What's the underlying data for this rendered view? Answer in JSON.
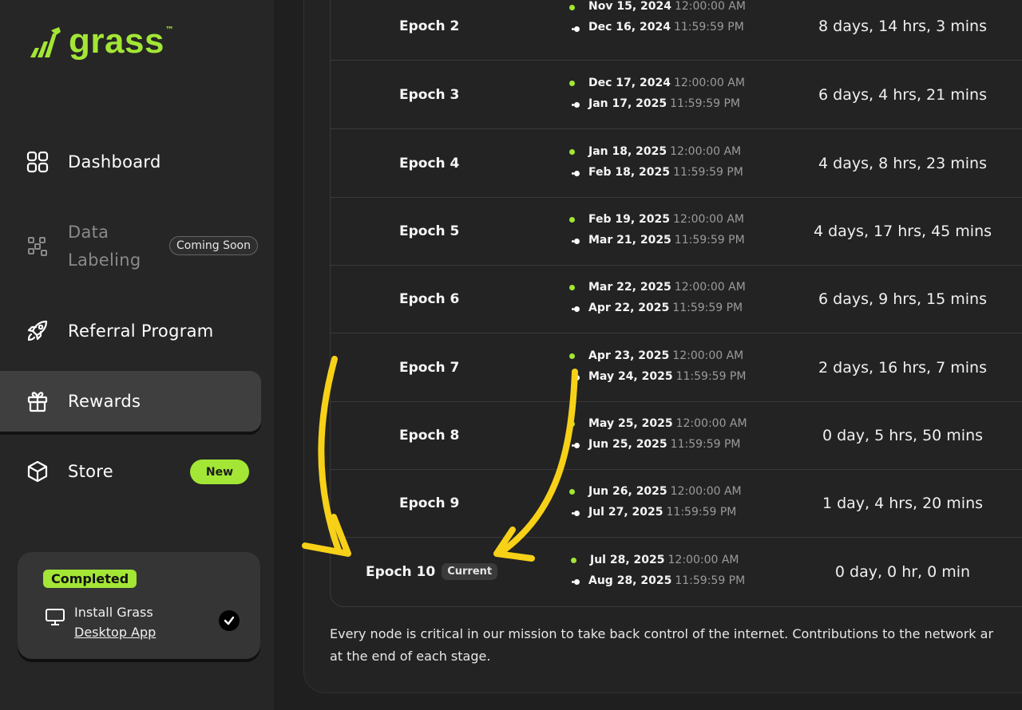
{
  "brand": {
    "name": "grass",
    "tm": "™",
    "accent": "#a3e635"
  },
  "sidebar": {
    "items": [
      {
        "label": "Dashboard",
        "icon": "grid-icon"
      },
      {
        "label": "Data Labeling",
        "line1": "Data",
        "line2": "Labeling",
        "icon": "data-labeling-icon",
        "badge": "Coming Soon"
      },
      {
        "label": "Referral Program",
        "icon": "rocket-icon"
      },
      {
        "label": "Rewards",
        "icon": "gift-icon",
        "active": true
      },
      {
        "label": "Store",
        "icon": "box-icon",
        "badge": "New"
      }
    ],
    "task": {
      "status": "Completed",
      "line1": "Install Grass",
      "line2": "Desktop App",
      "icon": "monitor-icon",
      "check_icon": "check-icon"
    }
  },
  "epochs": [
    {
      "name": "Epoch 2",
      "start_date": "Nov 15, 2024",
      "start_time": "12:00:00 AM",
      "end_date": "Dec 16, 2024",
      "end_time": "11:59:59 PM",
      "duration": "8 days, 14 hrs, 3 mins"
    },
    {
      "name": "Epoch 3",
      "start_date": "Dec 17, 2024",
      "start_time": "12:00:00 AM",
      "end_date": "Jan 17, 2025",
      "end_time": "11:59:59 PM",
      "duration": "6 days, 4 hrs, 21 mins"
    },
    {
      "name": "Epoch 4",
      "start_date": "Jan 18, 2025",
      "start_time": "12:00:00 AM",
      "end_date": "Feb 18, 2025",
      "end_time": "11:59:59 PM",
      "duration": "4 days, 8 hrs, 23 mins"
    },
    {
      "name": "Epoch 5",
      "start_date": "Feb 19, 2025",
      "start_time": "12:00:00 AM",
      "end_date": "Mar 21, 2025",
      "end_time": "11:59:59 PM",
      "duration": "4 days, 17 hrs, 45 mins"
    },
    {
      "name": "Epoch 6",
      "start_date": "Mar 22, 2025",
      "start_time": "12:00:00 AM",
      "end_date": "Apr 22, 2025",
      "end_time": "11:59:59 PM",
      "duration": "6 days, 9 hrs, 15 mins"
    },
    {
      "name": "Epoch 7",
      "start_date": "Apr 23, 2025",
      "start_time": "12:00:00 AM",
      "end_date": "May 24, 2025",
      "end_time": "11:59:59 PM",
      "duration": "2 days, 16 hrs, 7 mins"
    },
    {
      "name": "Epoch 8",
      "start_date": "May 25, 2025",
      "start_time": "12:00:00 AM",
      "end_date": "Jun 25, 2025",
      "end_time": "11:59:59 PM",
      "duration": "0 day, 5 hrs, 50 mins"
    },
    {
      "name": "Epoch 9",
      "start_date": "Jun 26, 2025",
      "start_time": "12:00:00 AM",
      "end_date": "Jul 27, 2025",
      "end_time": "11:59:59 PM",
      "duration": "1 day, 4 hrs, 20 mins"
    },
    {
      "name": "Epoch 10",
      "badge": "Current",
      "start_date": "Jul 28, 2025",
      "start_time": "12:00:00 AM",
      "end_date": "Aug 28, 2025",
      "end_time": "11:59:59 PM",
      "duration": "0 day, 0 hr, 0 min"
    }
  ],
  "footer": {
    "line1": "Every node is critical in our mission to take back control of the internet. Contributions to the network ar",
    "line2": "at the end of each stage."
  },
  "annotation_color": "#f7d117"
}
